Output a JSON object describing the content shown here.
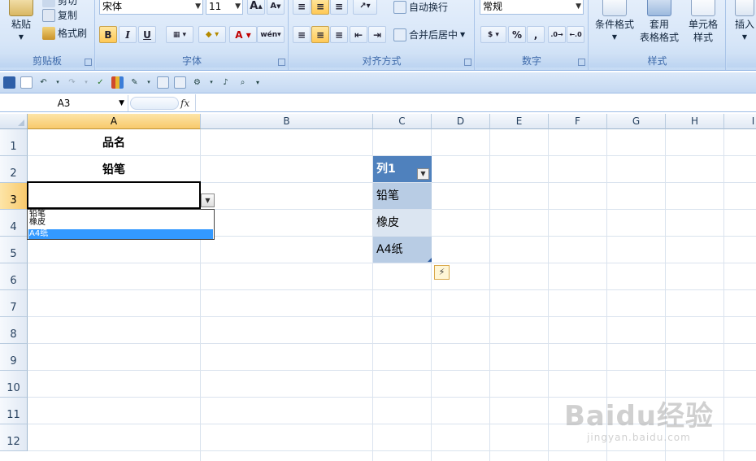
{
  "ribbon": {
    "clipboard": {
      "label": "剪贴板",
      "paste": "粘贴",
      "cut": "剪切",
      "copy": "复制",
      "format_painter": "格式刷"
    },
    "font": {
      "label": "字体",
      "font_name": "宋体",
      "font_size": "11",
      "bold": "B",
      "italic": "I",
      "underline": "U"
    },
    "alignment": {
      "label": "对齐方式",
      "wrap_text": "自动换行",
      "merge_center": "合并后居中"
    },
    "number": {
      "label": "数字",
      "format": "常规",
      "percent": "%",
      "comma": ","
    },
    "styles": {
      "label": "样式",
      "conditional": "条件格式",
      "table_format": "套用\n表格格式",
      "cell_styles": "单元格\n样式"
    },
    "cells": {
      "insert": "插入"
    }
  },
  "formula_bar": {
    "name_box": "A3",
    "fx": "fx",
    "formula": ""
  },
  "grid": {
    "columns": [
      "A",
      "B",
      "C",
      "D",
      "E",
      "F",
      "G",
      "H",
      "I"
    ],
    "rows": [
      "1",
      "2",
      "3",
      "4",
      "5",
      "6",
      "7",
      "8",
      "9",
      "10",
      "11",
      "12"
    ],
    "cells": {
      "A1": "品名",
      "A2": "铅笔",
      "A3": ""
    },
    "table": {
      "header": "列1",
      "rows": [
        "铅笔",
        "橡皮",
        "A4纸"
      ]
    },
    "dropdown_items": [
      "铅笔",
      "橡皮",
      "A4纸"
    ]
  },
  "watermark": {
    "main": "Baidu经验",
    "sub": "jingyan.baidu.com"
  }
}
